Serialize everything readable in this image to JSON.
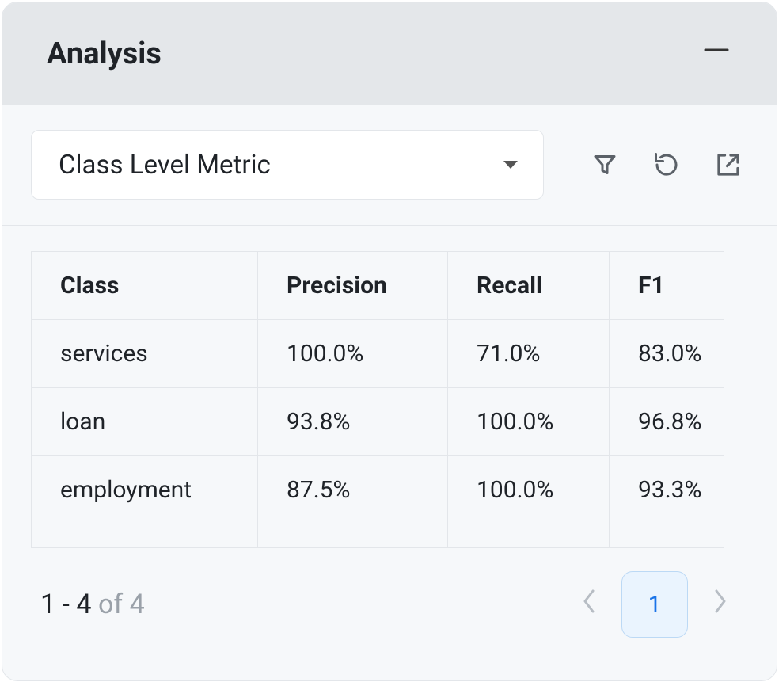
{
  "panel": {
    "title": "Analysis"
  },
  "toolbar": {
    "dropdown_label": "Class Level Metric"
  },
  "table": {
    "headers": {
      "class": "Class",
      "precision": "Precision",
      "recall": "Recall",
      "f1": "F1"
    },
    "rows": [
      {
        "class": "services",
        "precision": "100.0%",
        "recall": "71.0%",
        "f1": "83.0%"
      },
      {
        "class": "loan",
        "precision": "93.8%",
        "recall": "100.0%",
        "f1": "96.8%"
      },
      {
        "class": "employment",
        "precision": "87.5%",
        "recall": "100.0%",
        "f1": "93.3%"
      }
    ]
  },
  "pagination": {
    "range_start": "1",
    "range_end": "4",
    "of_word": "of",
    "total": "4",
    "current_page": "1"
  }
}
